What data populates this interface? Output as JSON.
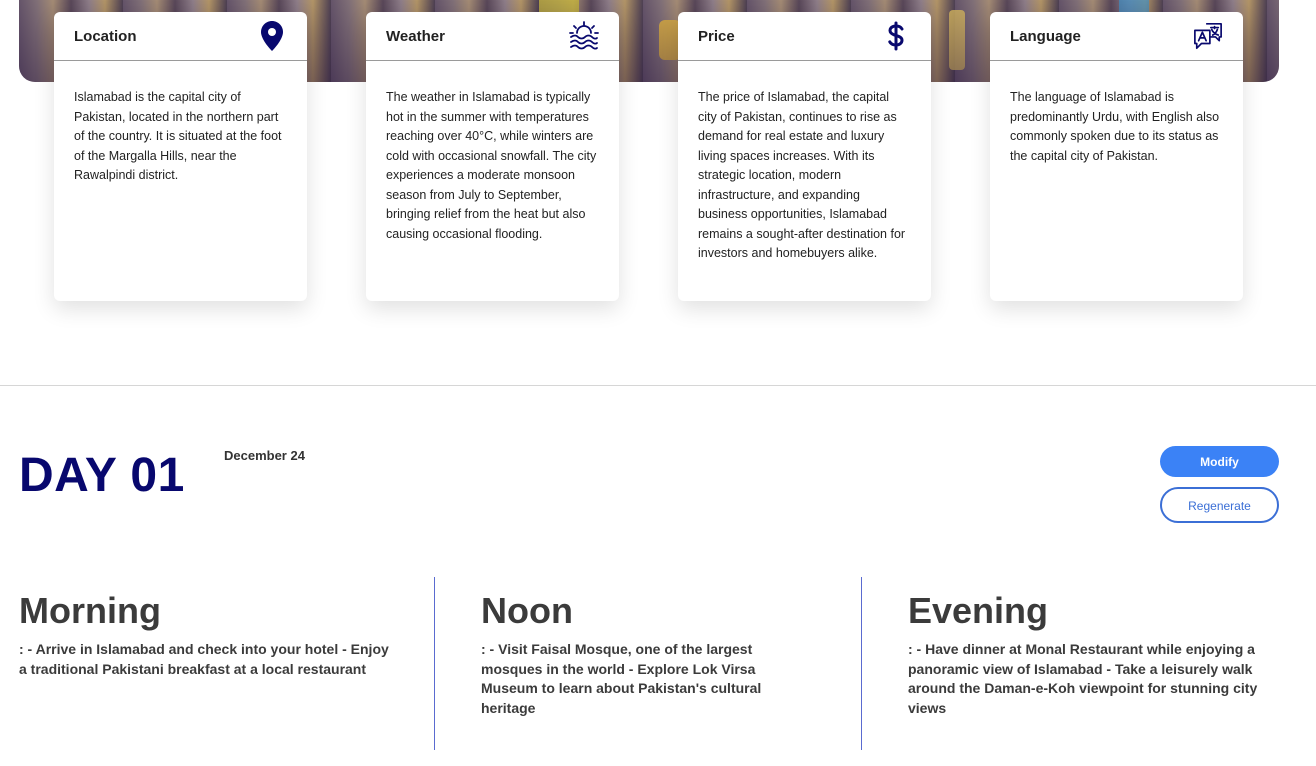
{
  "cards": [
    {
      "title": "Location",
      "icon": "map-pin-icon",
      "text": "Islamabad is the capital city of Pakistan, located in the northern part of the country. It is situated at the foot of the Margalla Hills, near the Rawalpindi district."
    },
    {
      "title": "Weather",
      "icon": "sunrise-waves-icon",
      "text": "The weather in Islamabad is typically hot in the summer with temperatures reaching over 40°C, while winters are cold with occasional snowfall. The city experiences a moderate monsoon season from July to September, bringing relief from the heat but also causing occasional flooding."
    },
    {
      "title": "Price",
      "icon": "dollar-icon",
      "text": "The price of Islamabad, the capital city of Pakistan, continues to rise as demand for real estate and luxury living spaces increases. With its strategic location, modern infrastructure, and expanding business opportunities, Islamabad remains a sought-after destination for investors and homebuyers alike."
    },
    {
      "title": "Language",
      "icon": "translate-icon",
      "text": "The language of Islamabad is predominantly Urdu, with English also commonly spoken due to its status as the capital city of Pakistan."
    }
  ],
  "day": {
    "title": "DAY 01",
    "date": "December 24",
    "modify_label": "Modify",
    "regenerate_label": "Regenerate"
  },
  "periods": [
    {
      "title": "Morning",
      "text": ": - Arrive in Islamabad and check into your hotel - Enjoy a traditional Pakistani breakfast at a local restaurant"
    },
    {
      "title": "Noon",
      "text": ": - Visit Faisal Mosque, one of the largest mosques in the world - Explore Lok Virsa Museum to learn about Pakistan's cultural heritage"
    },
    {
      "title": "Evening",
      "text": ": - Have dinner at Monal Restaurant while enjoying a panoramic view of Islamabad - Take a leisurely walk around the Daman-e-Koh viewpoint for stunning city views"
    }
  ],
  "colors": {
    "accent": "#08086e",
    "button": "#3b82f6"
  }
}
